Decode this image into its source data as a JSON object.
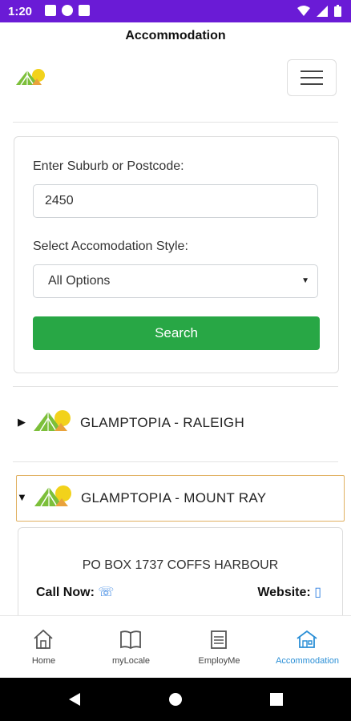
{
  "status_bar": {
    "time": "1:20"
  },
  "header": {
    "title": "Accommodation"
  },
  "search_form": {
    "suburb_label": "Enter Suburb or Postcode:",
    "suburb_value": "2450",
    "style_label": "Select Accomodation Style:",
    "style_selected": "All Options",
    "search_button": "Search"
  },
  "listings": [
    {
      "name": "GLAMPTOPIA - RALEIGH",
      "expanded": false
    },
    {
      "name": "GLAMPTOPIA - MOUNT RAY",
      "expanded": true
    }
  ],
  "detail": {
    "address": "PO BOX 1737 COFFS HARBOUR",
    "call_label": "Call Now:",
    "website_label": "Website:"
  },
  "bottom_nav": {
    "items": [
      {
        "label": "Home",
        "icon": "home-icon"
      },
      {
        "label": "myLocale",
        "icon": "book-icon"
      },
      {
        "label": "EmployMe",
        "icon": "document-icon"
      },
      {
        "label": "Accommodation",
        "icon": "house-icon",
        "active": true
      }
    ]
  },
  "colors": {
    "status_bar": "#6a1bd6",
    "search_button": "#28a745",
    "active_nav": "#2b8fd6"
  }
}
